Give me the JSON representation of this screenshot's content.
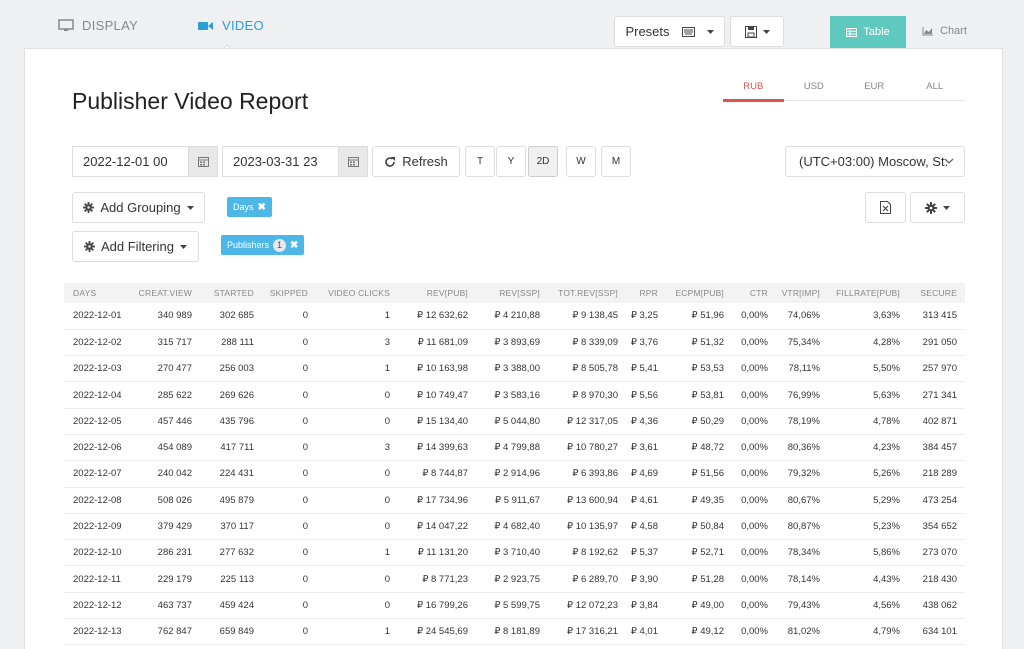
{
  "top_tabs": {
    "display": "DISPLAY",
    "video": "VIDEO"
  },
  "toolbar": {
    "presets_label": "Presets",
    "table_label": "Table",
    "chart_label": "Chart"
  },
  "page_title": "Publisher Video Report",
  "currencies": [
    "RUB",
    "USD",
    "EUR",
    "ALL"
  ],
  "active_currency": "RUB",
  "date_from": "2022-12-01 00",
  "date_to": "2023-03-31 23",
  "refresh_label": "Refresh",
  "periods": [
    "T",
    "Y",
    "2D",
    "W",
    "M"
  ],
  "active_period": "2D",
  "timezone": "(UTC+03:00) Moscow, St.",
  "add_grouping_label": "Add Grouping",
  "add_filtering_label": "Add Filtering",
  "chips": {
    "days": "Days",
    "publishers": "Publishers",
    "publishers_count": "1"
  },
  "colors": {
    "accent": "#2a9fd6",
    "teal": "#5fc9c0",
    "chip": "#4db8e8",
    "active_currency": "#d9534f"
  },
  "table": {
    "columns": [
      "DAYS",
      "CREAT.VIEW",
      "STARTED",
      "SKIPPED",
      "VIDEO CLICKS",
      "REV[PUB]",
      "REV[SSP]",
      "TOT.REV[SSP]",
      "RPR",
      "ECPM[PUB]",
      "CTR",
      "VTR[IMP]",
      "FILLRATE[PUB]",
      "SECURE"
    ],
    "rows": [
      [
        "2022-12-01",
        "340 989",
        "302 685",
        "0",
        "1",
        "₽ 12 632,62",
        "₽ 4 210,88",
        "₽ 9 138,45",
        "₽ 3,25",
        "₽ 51,96",
        "0,00%",
        "74,06%",
        "3,63%",
        "313 415"
      ],
      [
        "2022-12-02",
        "315 717",
        "288 111",
        "0",
        "3",
        "₽ 11 681,09",
        "₽ 3 893,69",
        "₽ 8 339,09",
        "₽ 3,76",
        "₽ 51,32",
        "0,00%",
        "75,34%",
        "4,28%",
        "291 050"
      ],
      [
        "2022-12-03",
        "270 477",
        "256 003",
        "0",
        "1",
        "₽ 10 163,98",
        "₽ 3 388,00",
        "₽ 8 505,78",
        "₽ 5,41",
        "₽ 53,53",
        "0,00%",
        "78,11%",
        "5,50%",
        "257 970"
      ],
      [
        "2022-12-04",
        "285 622",
        "269 626",
        "0",
        "0",
        "₽ 10 749,47",
        "₽ 3 583,16",
        "₽ 8 970,30",
        "₽ 5,56",
        "₽ 53,81",
        "0,00%",
        "76,99%",
        "5,63%",
        "271 341"
      ],
      [
        "2022-12-05",
        "457 446",
        "435 796",
        "0",
        "0",
        "₽ 15 134,40",
        "₽ 5 044,80",
        "₽ 12 317,05",
        "₽ 4,36",
        "₽ 50,29",
        "0,00%",
        "78,19%",
        "4,78%",
        "402 871"
      ],
      [
        "2022-12-06",
        "454 089",
        "417 711",
        "0",
        "3",
        "₽ 14 399,63",
        "₽ 4 799,88",
        "₽ 10 780,27",
        "₽ 3,61",
        "₽ 48,72",
        "0,00%",
        "80,36%",
        "4,23%",
        "384 457"
      ],
      [
        "2022-12-07",
        "240 042",
        "224 431",
        "0",
        "0",
        "₽ 8 744,87",
        "₽ 2 914,96",
        "₽ 6 393,86",
        "₽ 4,69",
        "₽ 51,56",
        "0,00%",
        "79,32%",
        "5,26%",
        "218 289"
      ],
      [
        "2022-12-08",
        "508 026",
        "495 879",
        "0",
        "0",
        "₽ 17 734,96",
        "₽ 5 911,67",
        "₽ 13 600,94",
        "₽ 4,61",
        "₽ 49,35",
        "0,00%",
        "80,67%",
        "5,29%",
        "473 254"
      ],
      [
        "2022-12-09",
        "379 429",
        "370 117",
        "0",
        "0",
        "₽ 14 047,22",
        "₽ 4 682,40",
        "₽ 10 135,97",
        "₽ 4,58",
        "₽ 50,84",
        "0,00%",
        "80,87%",
        "5,23%",
        "354 652"
      ],
      [
        "2022-12-10",
        "286 231",
        "277 632",
        "0",
        "1",
        "₽ 11 131,20",
        "₽ 3 710,40",
        "₽ 8 192,62",
        "₽ 5,37",
        "₽ 52,71",
        "0,00%",
        "78,34%",
        "5,86%",
        "273 070"
      ],
      [
        "2022-12-11",
        "229 179",
        "225 113",
        "0",
        "0",
        "₽ 8 771,23",
        "₽ 2 923,75",
        "₽ 6 289,70",
        "₽ 3,90",
        "₽ 51,28",
        "0,00%",
        "78,14%",
        "4,43%",
        "218 430"
      ],
      [
        "2022-12-12",
        "463 737",
        "459 424",
        "0",
        "0",
        "₽ 16 799,26",
        "₽ 5 599,75",
        "₽ 12 072,23",
        "₽ 3,84",
        "₽ 49,00",
        "0,00%",
        "79,43%",
        "4,56%",
        "438 062"
      ],
      [
        "2022-12-13",
        "762 847",
        "659 849",
        "0",
        "1",
        "₽ 24 545,69",
        "₽ 8 181,89",
        "₽ 17 316,21",
        "₽ 4,01",
        "₽ 49,12",
        "0,00%",
        "81,02%",
        "4,79%",
        "634 101"
      ]
    ]
  }
}
